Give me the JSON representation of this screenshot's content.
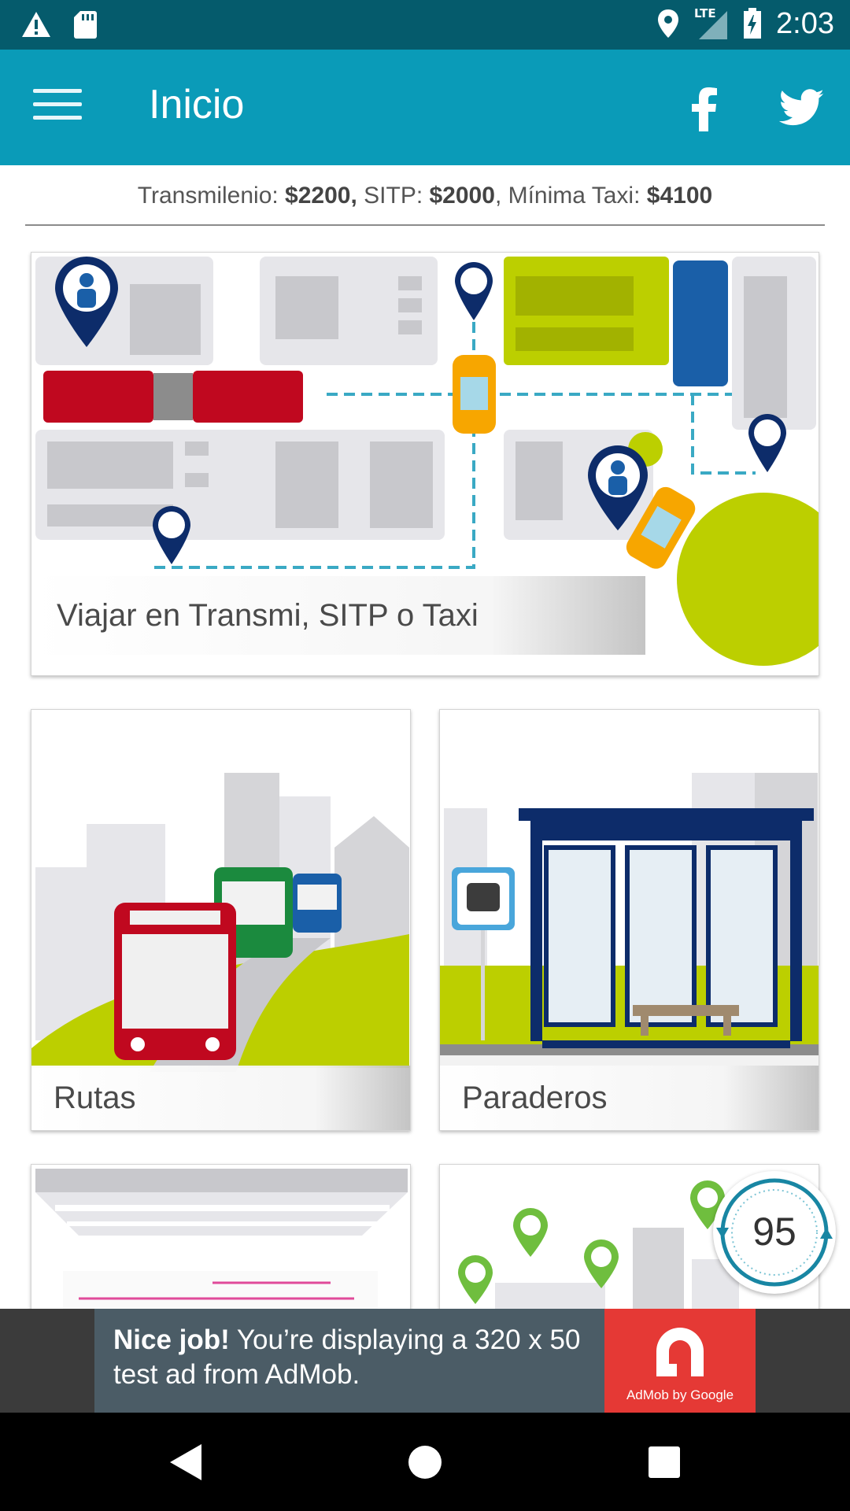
{
  "status_bar": {
    "time": "2:03",
    "network": "LTE",
    "icons": [
      "warning-icon",
      "sd-card-icon",
      "location-icon",
      "signal-icon",
      "battery-charging-icon"
    ]
  },
  "app_bar": {
    "title": "Inicio",
    "menu_icon": "hamburger-menu-icon",
    "facebook_icon": "facebook-icon",
    "twitter_icon": "twitter-icon"
  },
  "fares": {
    "transmilenio_label": "Transmilenio: ",
    "transmilenio_value": "$2200,",
    "sitp_label": " SITP: ",
    "sitp_value": "$2000",
    "taxi_label": ", Mínima Taxi: ",
    "taxi_value": "$4100"
  },
  "cards": {
    "main": {
      "label": "Viajar en Transmi, SITP o Taxi"
    },
    "rutas": {
      "label": "Rutas"
    },
    "paraderos": {
      "label": "Paraderos"
    }
  },
  "speed_badge": {
    "value": "95"
  },
  "ad": {
    "bold": "Nice job!",
    "text": " You’re displaying a 320 x 50 test ad from AdMob.",
    "brand": "AdMob by Google"
  },
  "colors": {
    "status_bar": "#055b6c",
    "app_bar": "#0a9bb8",
    "lime": "#bccf00",
    "red_bus": "#c0081f",
    "navy": "#0d2c6a",
    "ad_red": "#e53935"
  }
}
